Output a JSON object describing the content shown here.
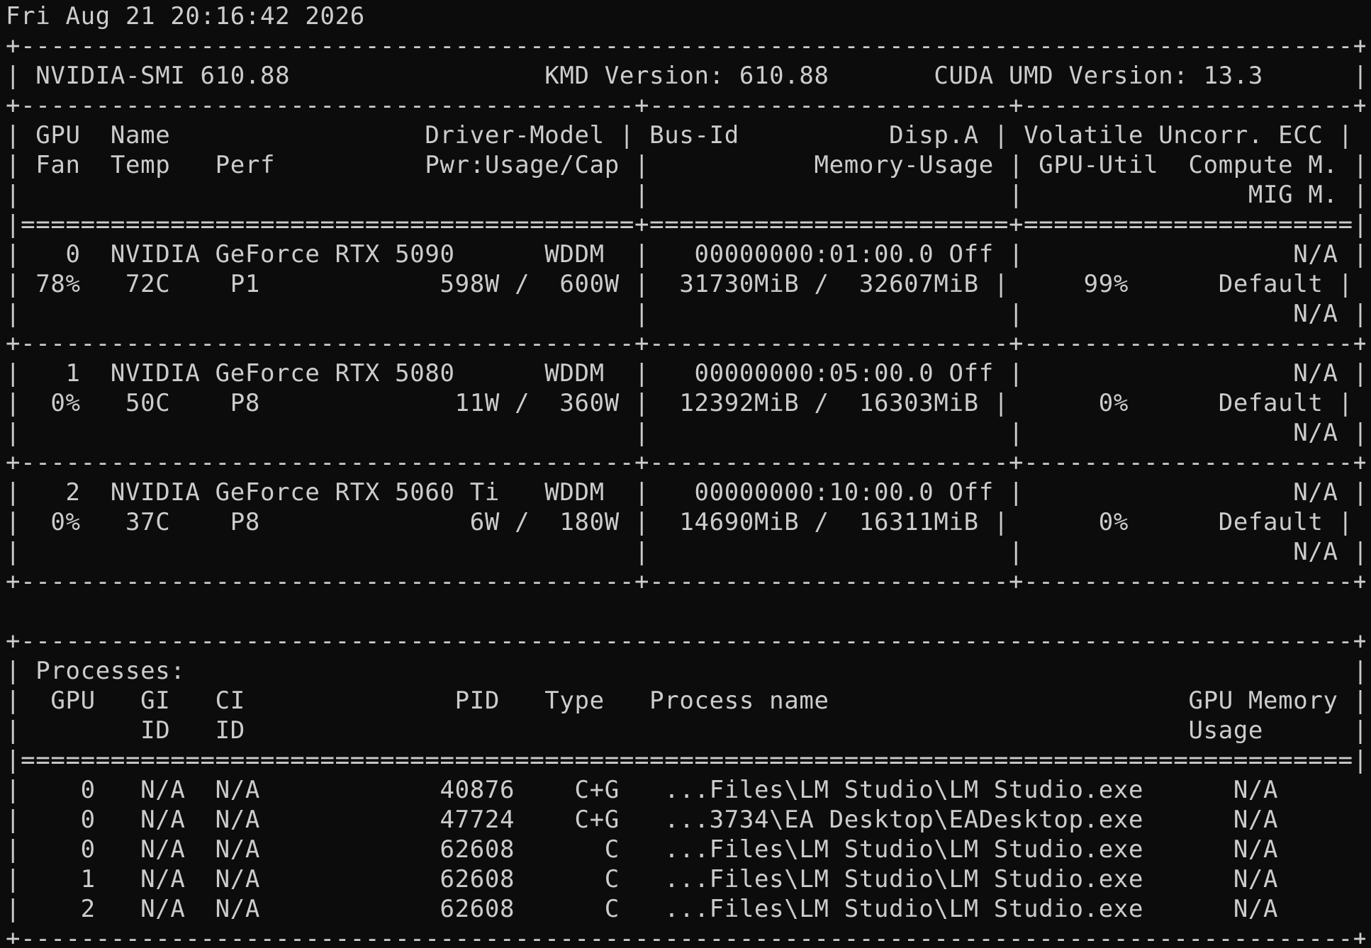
{
  "terminal": {
    "background": "#0c0c0c",
    "foreground": "#cccccc",
    "lines": [
      "Fri Aug 21 20:16:42 2026",
      "+-----------------------------------------------------------------------------------------+",
      "| NVIDIA-SMI 610.88                 KMD Version: 610.88       CUDA UMD Version: 13.3      |",
      "+-----------------------------------------+------------------------+----------------------+",
      "| GPU  Name                 Driver-Model | Bus-Id          Disp.A | Volatile Uncorr. ECC |",
      "| Fan  Temp   Perf          Pwr:Usage/Cap |           Memory-Usage | GPU-Util  Compute M. |",
      "|                                         |                        |               MIG M. |",
      "|=========================================+========================+======================|",
      "|   0  NVIDIA GeForce RTX 5090      WDDM  |   00000000:01:00.0 Off |                  N/A |",
      "| 78%   72C    P1            598W /  600W |  31730MiB /  32607MiB |     99%      Default |",
      "|                                         |                        |                  N/A |",
      "+-----------------------------------------+------------------------+----------------------+",
      "|   1  NVIDIA GeForce RTX 5080      WDDM  |   00000000:05:00.0 Off |                  N/A |",
      "|  0%   50C    P8             11W /  360W |  12392MiB /  16303MiB |      0%      Default |",
      "|                                         |                        |                  N/A |",
      "+-----------------------------------------+------------------------+----------------------+",
      "|   2  NVIDIA GeForce RTX 5060 Ti   WDDM  |   00000000:10:00.0 Off |                  N/A |",
      "|  0%   37C    P8              6W /  180W |  14690MiB /  16311MiB |      0%      Default |",
      "|                                         |                        |                  N/A |",
      "+-----------------------------------------+------------------------+----------------------+",
      "",
      "+-----------------------------------------------------------------------------------------+",
      "| Processes:                                                                              |",
      "|  GPU   GI   CI              PID   Type   Process name                        GPU Memory |",
      "|        ID   ID                                                               Usage      |",
      "|=========================================================================================|",
      "|    0   N/A  N/A            40876    C+G   ...Files\\LM Studio\\LM Studio.exe      N/A      |",
      "|    0   N/A  N/A            47724    C+G   ...3734\\EA Desktop\\EADesktop.exe      N/A      |",
      "|    0   N/A  N/A            62608      C   ...Files\\LM Studio\\LM Studio.exe      N/A      |",
      "|    1   N/A  N/A            62608      C   ...Files\\LM Studio\\LM Studio.exe      N/A      |",
      "|    2   N/A  N/A            62608      C   ...Files\\LM Studio\\LM Studio.exe      N/A      |",
      "+-----------------------------------------------------------------------------------------+"
    ]
  }
}
